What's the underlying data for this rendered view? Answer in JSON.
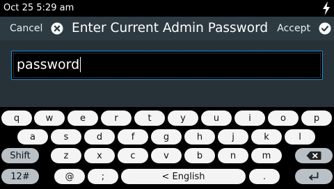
{
  "status": {
    "datetime": "Oct 25 5:29 am",
    "charging_icon": "bolt-icon"
  },
  "header": {
    "cancel_label": "Cancel",
    "cancel_icon": "close-circle-icon",
    "title": "Enter Current Admin Password",
    "accept_label": "Accept",
    "accept_icon": "check-circle-icon"
  },
  "password_field": {
    "value": "password"
  },
  "keyboard": {
    "row1": [
      "q",
      "w",
      "e",
      "r",
      "t",
      "y",
      "u",
      "i",
      "o",
      "p"
    ],
    "row2": [
      "a",
      "s",
      "d",
      "f",
      "g",
      "h",
      "j",
      "k",
      "l"
    ],
    "shift_label": "Shift",
    "row3": [
      "z",
      "x",
      "c",
      "v",
      "b",
      "n",
      "m"
    ],
    "backspace_icon": "backspace-icon",
    "symbols_label": "12#",
    "at_label": "@",
    "semicolon_label": ";",
    "space_label": "< English",
    "period_label": ".",
    "enter_icon": "enter-icon"
  },
  "colors": {
    "header_bg": "#2d3a42",
    "content_bg": "#273238",
    "field_border": "#1e90d6",
    "key_bg": "#f4f4f4",
    "mod_key_bg": "#b9c1c7"
  }
}
